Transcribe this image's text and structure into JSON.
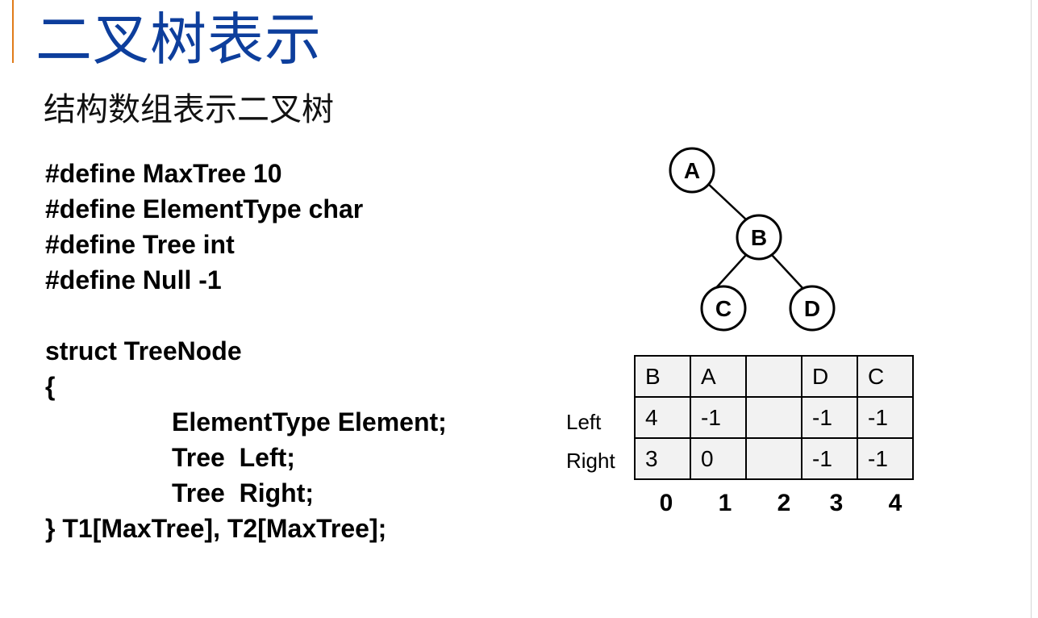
{
  "slide": {
    "title": "二叉树表示",
    "subtitle": "结构数组表示二叉树",
    "accent_color": "#E07B1A",
    "title_color": "#0D3E9C"
  },
  "code": {
    "lines": [
      "#define MaxTree 10",
      "#define ElementType char",
      "#define Tree int",
      "#define Null -1",
      "struct TreeNode",
      "{",
      "ElementType Element;",
      "Tree  Left;",
      "Tree  Right;",
      "} T1[MaxTree], T2[MaxTree];"
    ]
  },
  "tree": {
    "nodes": [
      "A",
      "B",
      "C",
      "D"
    ]
  },
  "array": {
    "elements": [
      "B",
      "A",
      "",
      "D",
      "C"
    ],
    "left_label": "Left",
    "right_label": "Right",
    "left": [
      "4",
      "-1",
      "",
      "-1",
      "-1"
    ],
    "right": [
      "3",
      "0",
      "",
      "-1",
      "-1"
    ],
    "indices": [
      "0",
      "1",
      "2",
      "3",
      "4"
    ]
  }
}
